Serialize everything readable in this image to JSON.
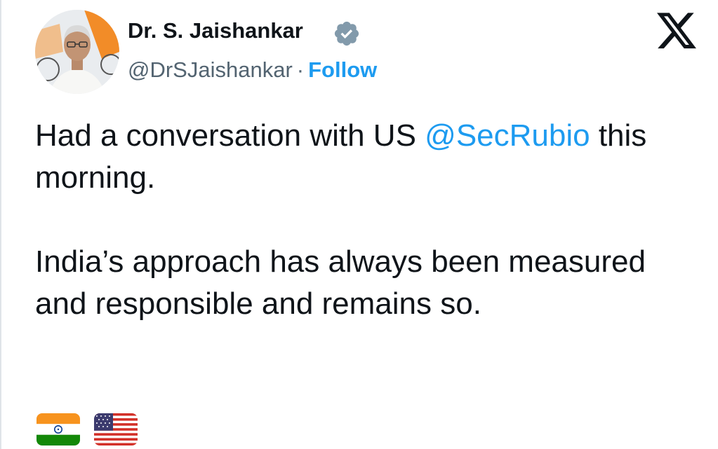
{
  "author": {
    "display_name": "Dr. S. Jaishankar",
    "handle": "@DrSJaishankar",
    "separator": "·",
    "follow_label": "Follow",
    "verified": true
  },
  "tweet": {
    "line1_prefix": "Had a conversation with US ",
    "mention": "@SecRubio",
    "line1_suffix": " this morning.",
    "paragraph2": "India’s approach has always been measured and responsible and remains so.",
    "emojis": [
      "flag-india",
      "flag-usa"
    ]
  },
  "colors": {
    "accent": "#1d9bf0",
    "text": "#0f1419",
    "secondary": "#536471",
    "verified_badge": "#829aab"
  },
  "icons": [
    "verified-badge-icon",
    "x-logo-icon"
  ]
}
